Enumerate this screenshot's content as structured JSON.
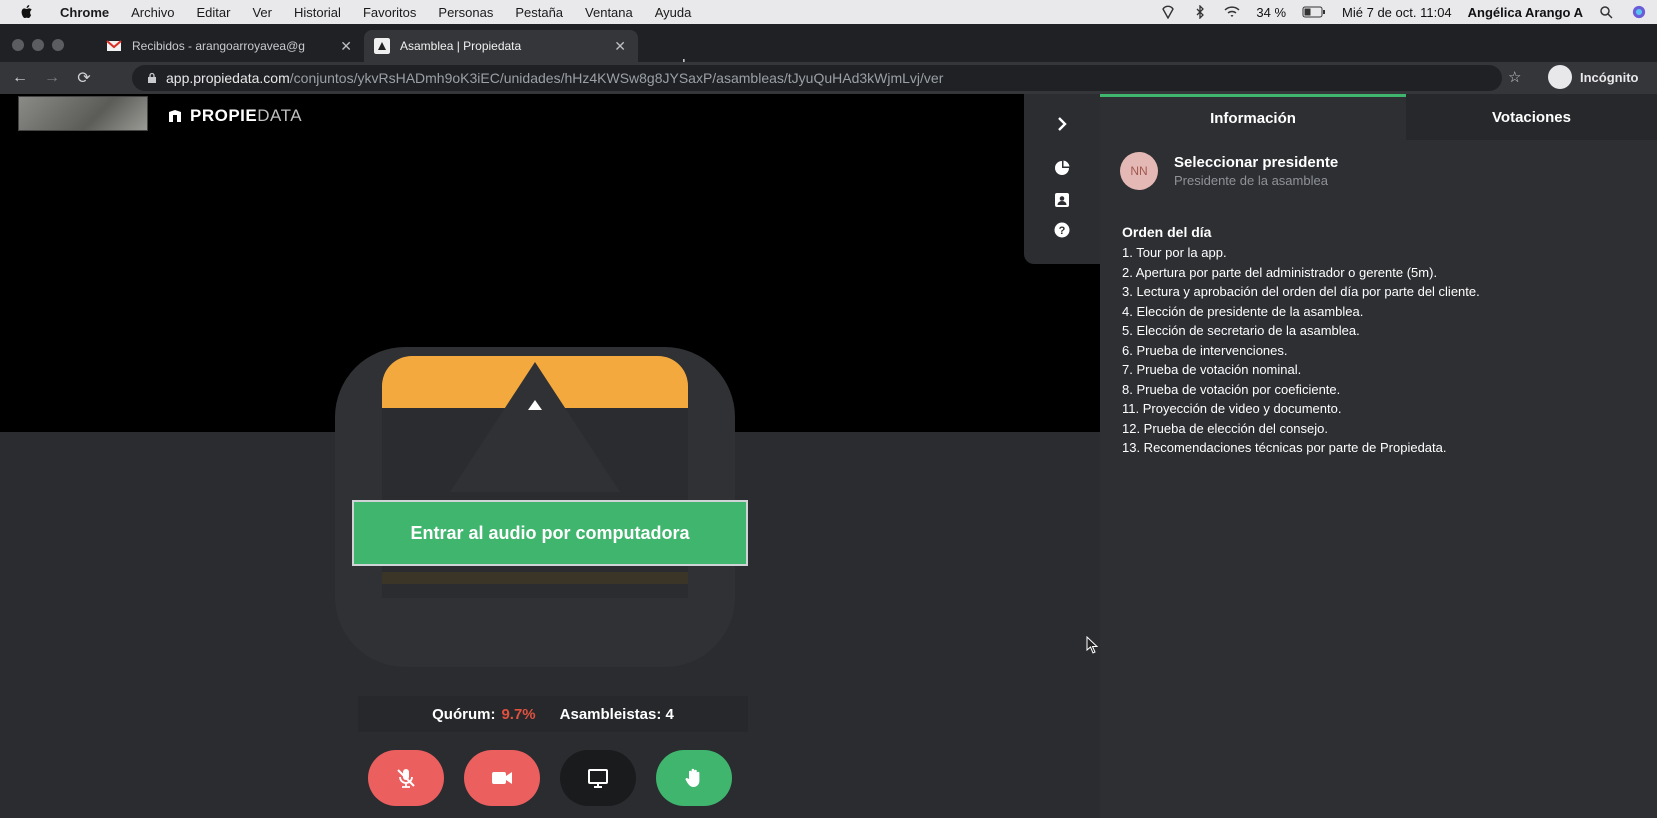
{
  "menubar": {
    "items": [
      "Chrome",
      "Archivo",
      "Editar",
      "Ver",
      "Historial",
      "Favoritos",
      "Personas",
      "Pestaña",
      "Ventana",
      "Ayuda"
    ],
    "battery": "34 %",
    "datetime": "Mié 7 de oct.  11:04",
    "user": "Angélica Arango A"
  },
  "browser": {
    "tabs": [
      {
        "label": "Recibidos - arangoarroyavea@g",
        "favicon": "gmail-icon"
      },
      {
        "label": "Asamblea | Propiedata",
        "favicon": "propiedata-icon"
      }
    ],
    "url_host": "app.propiedata.com",
    "url_path": "/conjuntos/ykvRsHADmh9oK3iEC/unidades/hHz4KWSw8g8JYSaxP/asambleas/tJyuQuHAd3kWjmLvj/ver",
    "incognito_label": "Incógnito"
  },
  "app": {
    "brand_bold": "PROPIE",
    "brand_light": "DATA",
    "audio_button": "Entrar al audio por computadora",
    "quorum_label": "Quórum:",
    "quorum_value": "9.7%",
    "attendees_label": "Asambleistas: 4",
    "colors": {
      "accent": "#3fb56e",
      "danger": "#ec5f5f",
      "quorum": "#e0513f"
    }
  },
  "panel": {
    "tab_info": "Información",
    "tab_votes": "Votaciones",
    "avatar_initials": "NN",
    "president_title": "Seleccionar presidente",
    "president_subtitle": "Presidente de la asamblea",
    "agenda_title": "Orden del día",
    "agenda": [
      "1. Tour por la app.",
      "2. Apertura por parte del administrador o gerente (5m).",
      "3. Lectura y aprobación del orden del día por parte del cliente.",
      "4. Elección de presidente de la asamblea.",
      "5. Elección de secretario de la asamblea.",
      "6. Prueba de intervenciones.",
      "7. Prueba de votación nominal.",
      "8. Prueba de votación por coeficiente.",
      "11. Proyección de video y documento.",
      "12. Prueba de elección del consejo.",
      "13. Recomendaciones técnicas por parte de Propiedata."
    ]
  }
}
